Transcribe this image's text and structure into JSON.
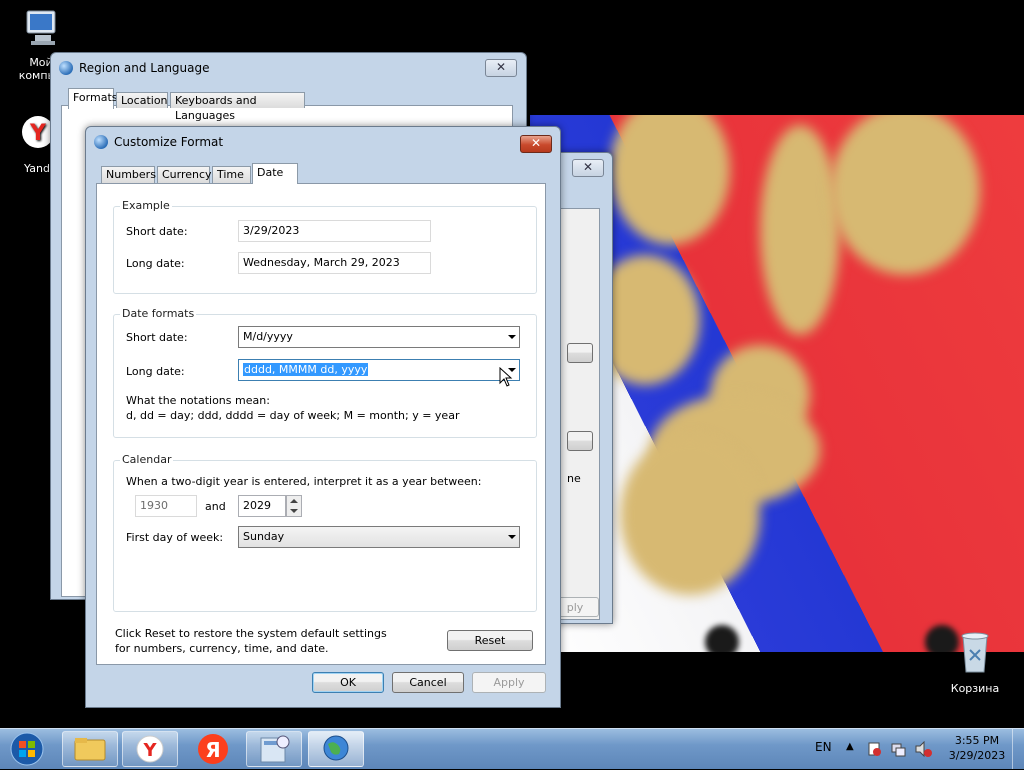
{
  "desktop": {
    "icons": [
      {
        "label": "Мой\nкомпьютер",
        "icon": "computer-icon"
      },
      {
        "label": "Yandex",
        "icon": "yandex-browser-icon"
      },
      {
        "label": "Корзина",
        "icon": "recycle-bin-icon"
      }
    ]
  },
  "region_window": {
    "title": "Region and Language",
    "tabs": [
      "Formats",
      "Location",
      "Keyboards and Languages"
    ],
    "active_tab": "Formats"
  },
  "bg_window": {
    "partial_text_1": "ne",
    "partial_text_2": "ply"
  },
  "customize_window": {
    "title": "Customize Format",
    "close_label": "✕",
    "tabs": [
      "Numbers",
      "Currency",
      "Time",
      "Date"
    ],
    "active_tab": "Date",
    "example": {
      "group_label": "Example",
      "short_label": "Short date:",
      "short_value": "3/29/2023",
      "long_label": "Long date:",
      "long_value": "Wednesday, March 29, 2023"
    },
    "date_formats": {
      "group_label": "Date formats",
      "short_label": "Short date:",
      "short_value": "M/d/yyyy",
      "long_label": "Long date:",
      "long_value": "dddd, MMMM dd, yyyy",
      "notation_title": "What the notations mean:",
      "notation_text": "d, dd = day;  ddd, dddd = day of week;  M = month;  y = year"
    },
    "calendar": {
      "group_label": "Calendar",
      "two_digit_text": "When a two-digit year is entered, interpret it as a year between:",
      "year_from": "1930",
      "and_label": "and",
      "year_to": "2029",
      "first_day_label": "First day of week:",
      "first_day_value": "Sunday"
    },
    "reset_text": "Click Reset to restore the system default settings for numbers, currency, time, and date.",
    "reset_button": "Reset",
    "ok_button": "OK",
    "cancel_button": "Cancel",
    "apply_button": "Apply"
  },
  "taskbar": {
    "language": "EN",
    "time": "3:55 PM",
    "date": "3/29/2023",
    "apps": [
      "start-orb",
      "file-explorer",
      "yandex-browser",
      "yandex",
      "control-panel",
      "region-language"
    ]
  }
}
